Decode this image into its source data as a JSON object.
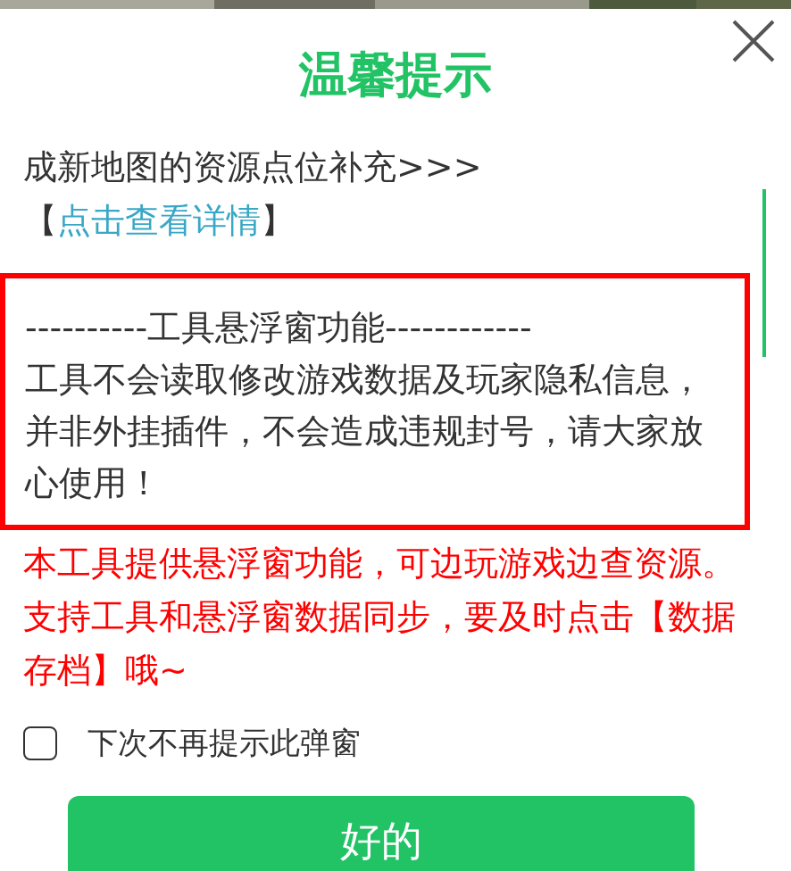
{
  "dialog": {
    "title": "温馨提示",
    "intro": {
      "text": "成新地图的资源点位补充>>>【",
      "link": "点击查看详情",
      "suffix": "】"
    },
    "notice_box": {
      "heading": "----------工具悬浮窗功能------------",
      "text": "工具不会读取修改游戏数据及玩家隐私信息，并非外挂插件，不会造成违规封号，请大家放心使用！"
    },
    "warning": "本工具提供悬浮窗功能，可边玩游戏边查资源。支持工具和悬浮窗数据同步，要及时点击【数据存档】哦~",
    "checkbox": {
      "label": "下次不再提示此弹窗",
      "checked": false
    },
    "button": "好的"
  }
}
